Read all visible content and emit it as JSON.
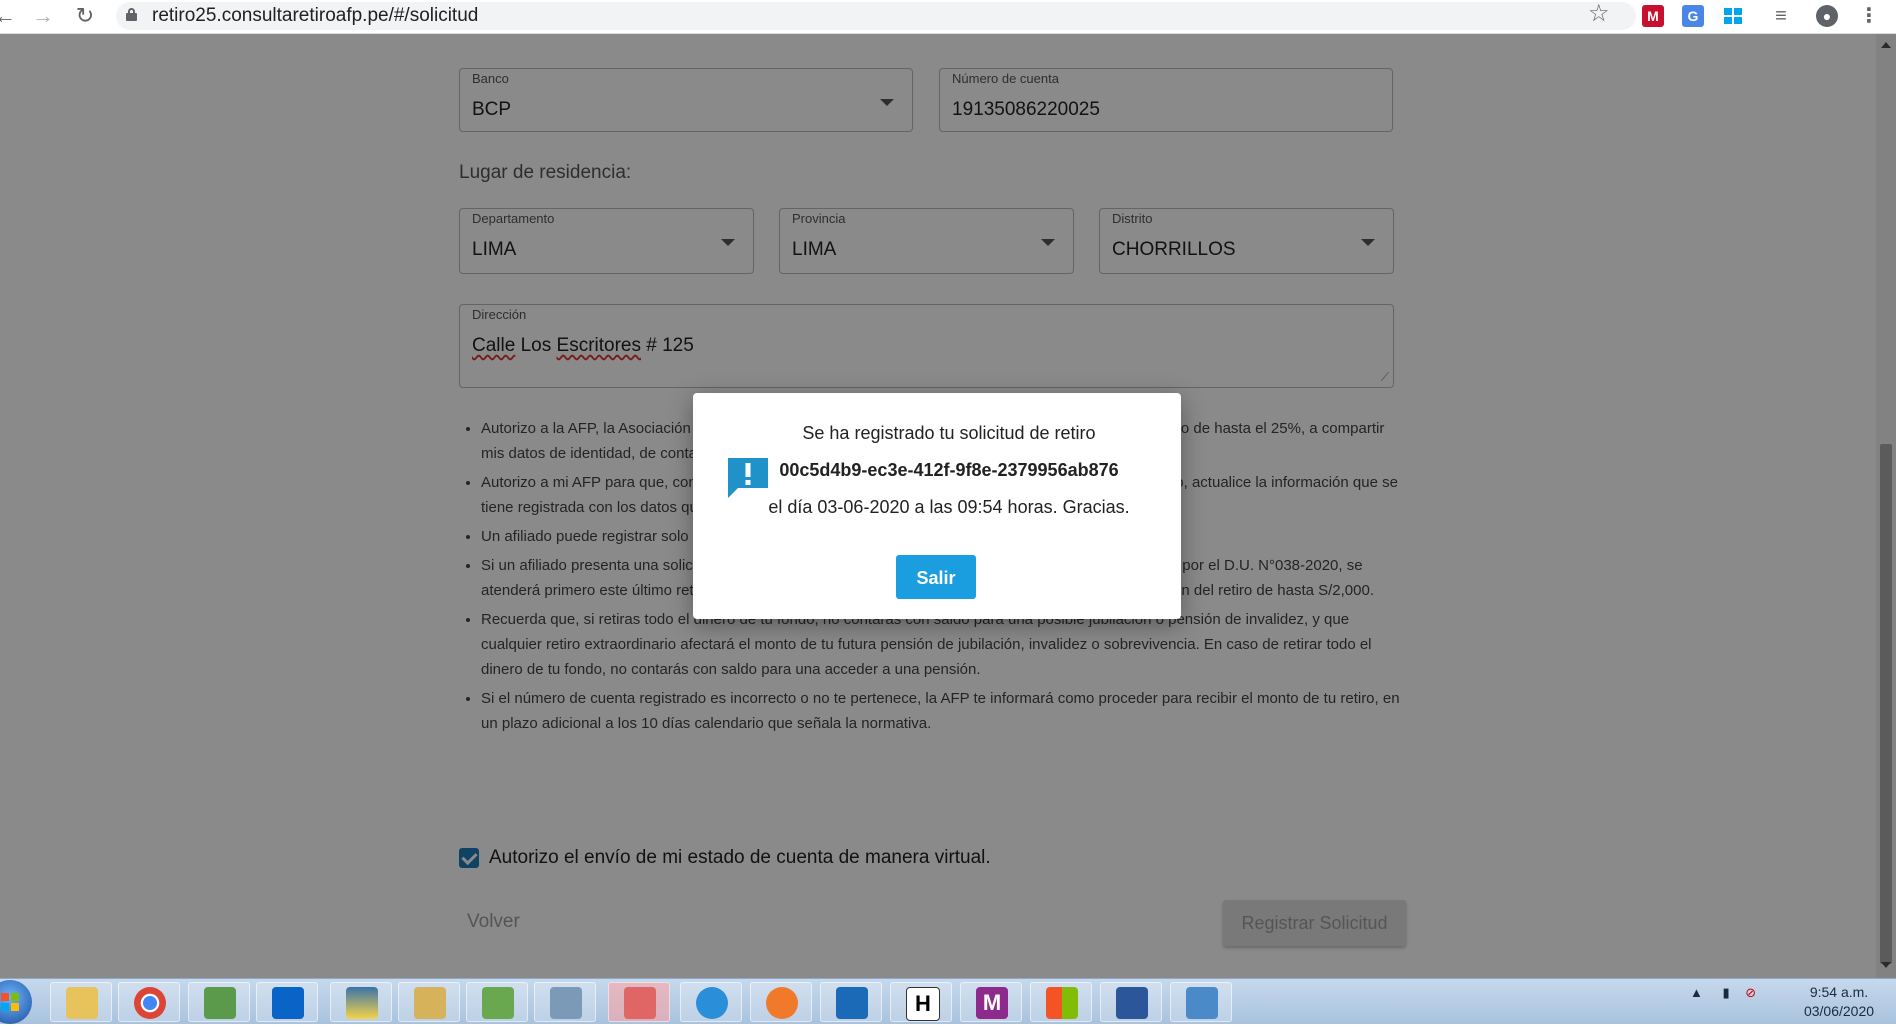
{
  "browser": {
    "url": "retiro25.consultaretiroafp.pe/#/solicitud"
  },
  "form": {
    "banco": {
      "label": "Banco",
      "value": "BCP"
    },
    "cuenta": {
      "label": "Número de cuenta",
      "value": "19135086220025"
    },
    "residencia_title": "Lugar de residencia:",
    "departamento": {
      "label": "Departamento",
      "value": "LIMA"
    },
    "provincia": {
      "label": "Provincia",
      "value": "LIMA"
    },
    "distrito": {
      "label": "Distrito",
      "value": "CHORRILLOS"
    },
    "direccion": {
      "label": "Dirección",
      "value_part1": "Calle",
      "value_part2": "Los",
      "value_part3": "Escritores",
      "value_part4": "# 125"
    }
  },
  "terms": [
    "Autorizo a la AFP, la Asociación de AFP y a las entidades financieras que participan en el proceso de retiro de hasta el 25%, a compartir mis datos de identidad, de contacto y bancarios, con el fin de realizar el abono del monto de retiro.",
    "Autorizo a mi AFP para que, con la información proporcionada, y de considerarlo conveniente o necesario, actualice la información que se tiene registrada con los datos que se consignan en la presente solicitud.",
    "Un afiliado puede registrar solo una solicitud.",
    "Si un afiliado presenta una solicitud de retiro de hasta el 25% y tiene pendiente el retiro de hasta S/ 2000 por el D.U. N°038-2020, se atenderá primero este último retiro y una vez que la solicitud sea confirmada, se procederá con la atención del retiro de hasta S/2,000.",
    "Recuerda que, si retiras todo el dinero de tu fondo, no contarás con saldo para una posible jubilación o pensión de invalidez, y que cualquier retiro extraordinario afectará el monto de tu futura pensión de jubilación, invalidez o sobrevivencia. En caso de retirar todo el dinero de tu fondo, no contarás con saldo para una acceder a una pensión.",
    "Si el número de cuenta registrado es incorrecto o no te pertenece, la AFP te informará como proceder para recibir el monto de tu retiro, en un plazo adicional a los 10 días calendario que señala la normativa."
  ],
  "checkbox_label": "Autorizo el envío de mi estado de cuenta de manera virtual.",
  "buttons": {
    "volver": "Volver",
    "registrar": "Registrar Solicitud"
  },
  "dialog": {
    "line1": "Se ha registrado tu solicitud de retiro",
    "code": "00c5d4b9-ec3e-412f-9f8e-2379956ab876",
    "line3": "el día 03-06-2020 a las 09:54 horas. Gracias.",
    "button": "Salir",
    "icon": "exclamation-chat-icon",
    "accent": "#1a9ee0"
  },
  "taskbar": {
    "time": "9:54 a.m.",
    "date": "03/06/2020",
    "icons": [
      "file-explorer-icon",
      "chrome-icon",
      "package-icon",
      "outlook-icon",
      "python-icon",
      "search-folder-icon",
      "editor-icon",
      "network-icon",
      "snipping-tool-icon",
      "ie-icon",
      "pen-icon",
      "wireshark-icon",
      "h-icon",
      "mysys-icon",
      "windows-flag-icon",
      "word-icon",
      "photo-icon"
    ],
    "h_letter": "H",
    "ms_letter": "M"
  }
}
